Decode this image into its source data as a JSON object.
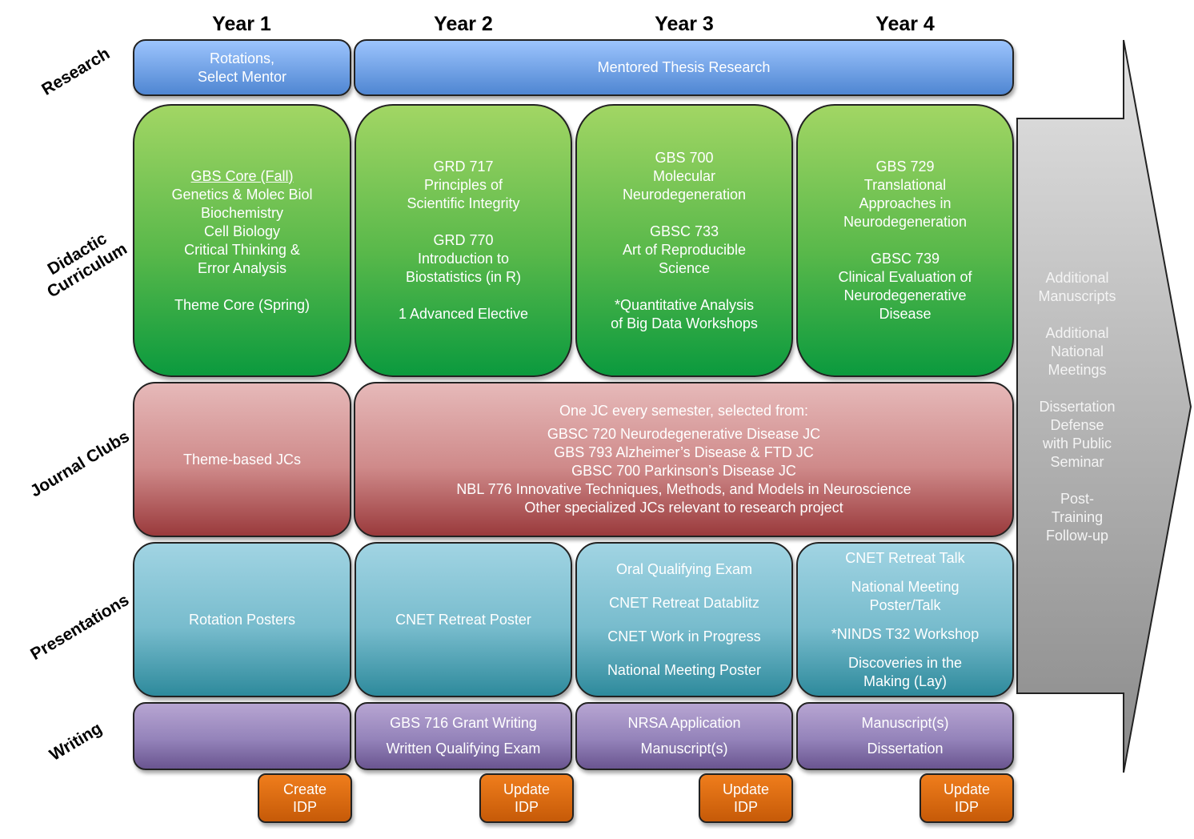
{
  "years": [
    "Year 1",
    "Year 2",
    "Year 3",
    "Year 4"
  ],
  "rows": {
    "research": "Research",
    "didactic": "Didactic Curriculum",
    "journal": "Journal Clubs",
    "presentations": "Presentations",
    "writing": "Writing"
  },
  "research": {
    "y1": [
      "Rotations,",
      "Select Mentor"
    ],
    "y2_4": "Mentored Thesis Research"
  },
  "didactic": {
    "y1": {
      "heading": "GBS Core (Fall)",
      "lines": [
        "Genetics & Molec Biol",
        "Biochemistry",
        "Cell Biology",
        "Critical Thinking &",
        "Error Analysis"
      ],
      "extra": "Theme Core (Spring)"
    },
    "y2": {
      "a": [
        "GRD 717",
        "Principles of",
        "Scientific Integrity"
      ],
      "b": [
        "GRD 770",
        "Introduction to",
        "Biostatistics (in R)"
      ],
      "c": "1 Advanced Elective"
    },
    "y3": {
      "a": [
        "GBS 700",
        "Molecular",
        "Neurodegeneration"
      ],
      "b": [
        "GBSC 733",
        "Art of Reproducible",
        "Science"
      ],
      "c": [
        "*Quantitative Analysis",
        "of Big Data Workshops"
      ]
    },
    "y4": {
      "a": [
        "GBS 729",
        "Translational",
        "Approaches in",
        "Neurodegeneration"
      ],
      "b": [
        "GBSC 739",
        "Clinical Evaluation of",
        "Neurodegenerative",
        "Disease"
      ]
    }
  },
  "journal": {
    "y1": "Theme-based JCs",
    "y2_4": {
      "intro": "One JC every semester, selected from:",
      "items": [
        "GBSC 720 Neurodegenerative Disease JC",
        "GBS 793 Alzheimer’s Disease & FTD JC",
        "GBSC 700 Parkinson’s Disease JC",
        "NBL 776 Innovative Techniques, Methods, and Models in Neuroscience",
        "Other specialized JCs relevant to research project"
      ]
    }
  },
  "presentations": {
    "y1": "Rotation Posters",
    "y2": "CNET Retreat Poster",
    "y3": [
      "Oral Qualifying Exam",
      "CNET Retreat Datablitz",
      "CNET Work in Progress",
      "National Meeting Poster"
    ],
    "y4": [
      "CNET Retreat Talk",
      "National Meeting Poster/Talk",
      "*NINDS T32 Workshop",
      "Discoveries in the Making (Lay)"
    ]
  },
  "writing": {
    "y2": [
      "GBS 716 Grant Writing",
      "Written Qualifying Exam"
    ],
    "y3": [
      "NRSA Application",
      "Manuscript(s)"
    ],
    "y4": [
      "Manuscript(s)",
      "Dissertation"
    ]
  },
  "idp": [
    [
      "Create",
      "IDP"
    ],
    [
      "Update",
      "IDP"
    ],
    [
      "Update",
      "IDP"
    ],
    [
      "Update",
      "IDP"
    ]
  ],
  "post": [
    [
      "Additional",
      "Manuscripts"
    ],
    [
      "Additional",
      "National",
      "Meetings"
    ],
    [
      "Dissertation",
      "Defense",
      "with Public",
      "Seminar"
    ],
    [
      "Post-",
      "Training",
      "Follow-up"
    ]
  ],
  "colors": {
    "research": "#4f86d2",
    "didactic": "#0b9a3e",
    "journal": "#9a3a3c",
    "presentations": "#2e8a9c",
    "writing": "#6a5590",
    "idp": "#e06c12",
    "arrow": "#a8a8a8"
  }
}
